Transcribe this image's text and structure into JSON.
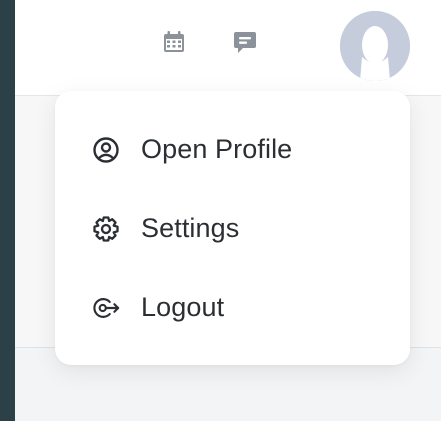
{
  "header": {
    "icons": [
      "calendar-icon",
      "chat-icon"
    ],
    "avatar": "user-avatar"
  },
  "profile_menu": {
    "items": [
      {
        "label": "Open Profile",
        "icon": "user-circle-icon"
      },
      {
        "label": "Settings",
        "icon": "gear-icon"
      },
      {
        "label": "Logout",
        "icon": "logout-icon"
      }
    ]
  },
  "colors": {
    "backdrop": "#2c4047",
    "icon_gray": "#8b929a",
    "avatar_bg": "#c5ccdc",
    "menu_text": "#2b2f33"
  }
}
